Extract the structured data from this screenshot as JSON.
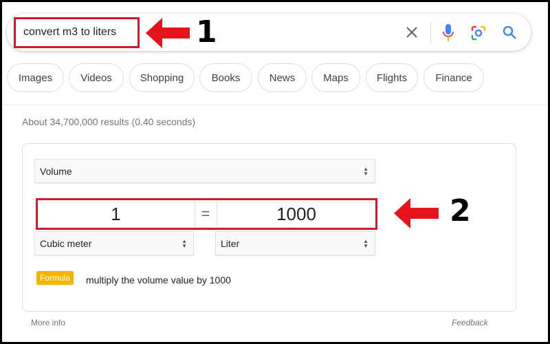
{
  "search": {
    "query": "convert m3 to liters",
    "icons": [
      "close-icon",
      "microphone-icon",
      "lens-icon",
      "search-icon"
    ]
  },
  "annotations": {
    "first": "1",
    "second": "2",
    "arrow_color": "#e3151a",
    "box_color": "#c8202a"
  },
  "chips": [
    "Images",
    "Videos",
    "Shopping",
    "Books",
    "News",
    "Maps",
    "Flights",
    "Finance"
  ],
  "stats": "About 34,700,000 results (0.40 seconds)",
  "converter": {
    "category": "Volume",
    "from_value": "1",
    "equals": "=",
    "to_value": "1000",
    "from_unit": "Cubic meter",
    "to_unit": "Liter",
    "formula_label": "Formula",
    "formula_text": "multiply the volume value by 1000",
    "formula_color": "#f4b400"
  },
  "footer": {
    "more_info": "More info",
    "feedback": "Feedback"
  }
}
